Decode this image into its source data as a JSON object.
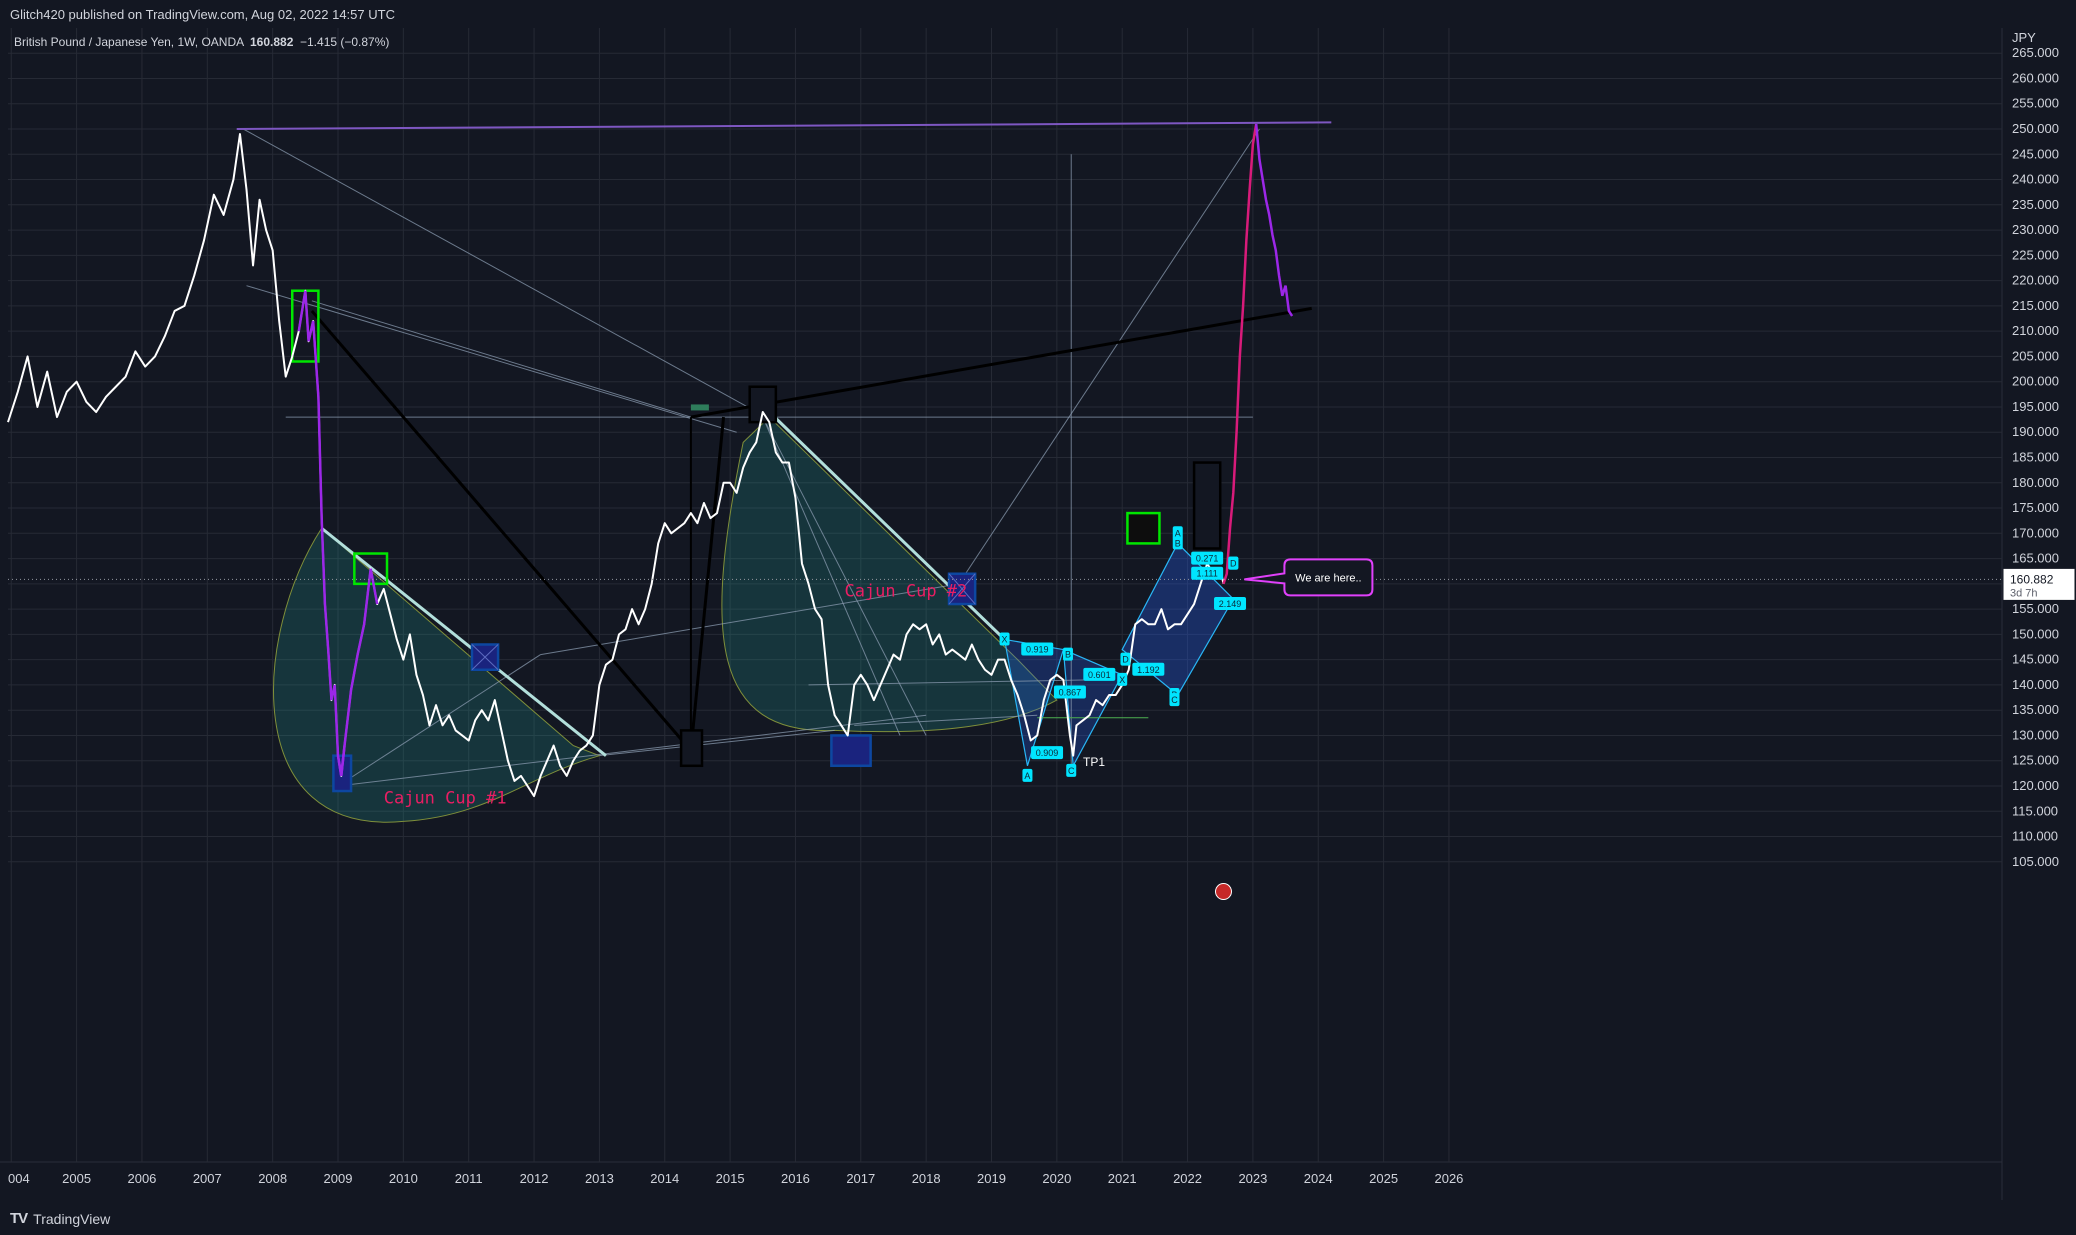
{
  "header": {
    "published": "Glitch420 published on TradingView.com, Aug 02, 2022 14:57 UTC"
  },
  "footer": {
    "brand": "TradingView"
  },
  "chart_data": {
    "type": "line",
    "legend": {
      "symbol": "British Pound / Japanese Yen, 1W, OANDA",
      "last": "160.882",
      "change": "−1.415 (−0.87%)"
    },
    "currency": "JPY",
    "last_price": 160.882,
    "last_price_label": "160.882",
    "countdown": "3d 7h",
    "x_ticks": [
      "004",
      "2005",
      "2006",
      "2007",
      "2008",
      "2009",
      "2010",
      "2011",
      "2012",
      "2013",
      "2014",
      "2015",
      "2016",
      "2017",
      "2018",
      "2019",
      "2020",
      "2021",
      "2022",
      "2023",
      "2024",
      "2025",
      "2026"
    ],
    "y_ticks": [
      "105.000",
      "110.000",
      "115.000",
      "120.000",
      "125.000",
      "130.000",
      "135.000",
      "140.000",
      "145.000",
      "150.000",
      "155.000",
      "160.000",
      "165.000",
      "170.000",
      "175.000",
      "180.000",
      "185.000",
      "190.000",
      "195.000",
      "200.000",
      "205.000",
      "210.000",
      "215.000",
      "220.000",
      "225.000",
      "230.000",
      "235.000",
      "240.000",
      "245.000",
      "250.000",
      "255.000",
      "260.000",
      "265.000"
    ],
    "ylim": [
      100,
      270
    ],
    "xlim": [
      2003.95,
      2027.5
    ],
    "price_series": {
      "color": "#ffffff",
      "points": [
        [
          2003.95,
          192
        ],
        [
          2004.1,
          198
        ],
        [
          2004.25,
          205
        ],
        [
          2004.4,
          195
        ],
        [
          2004.55,
          202
        ],
        [
          2004.7,
          193
        ],
        [
          2004.85,
          198
        ],
        [
          2005.0,
          200
        ],
        [
          2005.15,
          196
        ],
        [
          2005.3,
          194
        ],
        [
          2005.45,
          197
        ],
        [
          2005.6,
          199
        ],
        [
          2005.75,
          201
        ],
        [
          2005.9,
          206
        ],
        [
          2006.05,
          203
        ],
        [
          2006.2,
          205
        ],
        [
          2006.35,
          209
        ],
        [
          2006.5,
          214
        ],
        [
          2006.65,
          215
        ],
        [
          2006.8,
          221
        ],
        [
          2006.95,
          228
        ],
        [
          2007.1,
          237
        ],
        [
          2007.25,
          233
        ],
        [
          2007.4,
          240
        ],
        [
          2007.5,
          249
        ],
        [
          2007.6,
          238
        ],
        [
          2007.7,
          223
        ],
        [
          2007.8,
          236
        ],
        [
          2007.9,
          230
        ],
        [
          2008.0,
          226
        ],
        [
          2008.1,
          212
        ],
        [
          2008.2,
          201
        ],
        [
          2008.3,
          205
        ],
        [
          2008.4,
          210
        ],
        [
          2008.5,
          218
        ],
        [
          2008.55,
          208
        ],
        [
          2008.62,
          212
        ],
        [
          2008.7,
          197
        ],
        [
          2008.75,
          173
        ],
        [
          2008.8,
          156
        ],
        [
          2008.85,
          147
        ],
        [
          2008.9,
          137
        ],
        [
          2008.95,
          140
        ],
        [
          2009.0,
          126
        ],
        [
          2009.05,
          122
        ],
        [
          2009.1,
          128
        ],
        [
          2009.2,
          139
        ],
        [
          2009.3,
          146
        ],
        [
          2009.4,
          152
        ],
        [
          2009.5,
          163
        ],
        [
          2009.6,
          156
        ],
        [
          2009.7,
          159
        ],
        [
          2009.8,
          154
        ],
        [
          2009.9,
          149
        ],
        [
          2010.0,
          145
        ],
        [
          2010.1,
          150
        ],
        [
          2010.2,
          142
        ],
        [
          2010.3,
          138
        ],
        [
          2010.4,
          132
        ],
        [
          2010.5,
          136
        ],
        [
          2010.6,
          132
        ],
        [
          2010.7,
          134
        ],
        [
          2010.8,
          131
        ],
        [
          2010.9,
          130
        ],
        [
          2011.0,
          129
        ],
        [
          2011.1,
          133
        ],
        [
          2011.2,
          135
        ],
        [
          2011.3,
          133
        ],
        [
          2011.4,
          137
        ],
        [
          2011.5,
          131
        ],
        [
          2011.6,
          125
        ],
        [
          2011.7,
          121
        ],
        [
          2011.8,
          122
        ],
        [
          2011.9,
          120
        ],
        [
          2012.0,
          118
        ],
        [
          2012.1,
          122
        ],
        [
          2012.2,
          125
        ],
        [
          2012.3,
          128
        ],
        [
          2012.4,
          124
        ],
        [
          2012.5,
          122
        ],
        [
          2012.6,
          125
        ],
        [
          2012.7,
          127
        ],
        [
          2012.8,
          128
        ],
        [
          2012.9,
          130
        ],
        [
          2013.0,
          140
        ],
        [
          2013.1,
          144
        ],
        [
          2013.2,
          145
        ],
        [
          2013.3,
          150
        ],
        [
          2013.4,
          151
        ],
        [
          2013.5,
          155
        ],
        [
          2013.6,
          152
        ],
        [
          2013.7,
          155
        ],
        [
          2013.8,
          160
        ],
        [
          2013.9,
          168
        ],
        [
          2014.0,
          172
        ],
        [
          2014.1,
          170
        ],
        [
          2014.2,
          171
        ],
        [
          2014.3,
          172
        ],
        [
          2014.4,
          174
        ],
        [
          2014.5,
          172
        ],
        [
          2014.6,
          176
        ],
        [
          2014.7,
          173
        ],
        [
          2014.8,
          174
        ],
        [
          2014.9,
          180
        ],
        [
          2015.0,
          180
        ],
        [
          2015.1,
          178
        ],
        [
          2015.2,
          183
        ],
        [
          2015.3,
          186
        ],
        [
          2015.4,
          188
        ],
        [
          2015.5,
          194
        ],
        [
          2015.6,
          192
        ],
        [
          2015.7,
          186
        ],
        [
          2015.8,
          184
        ],
        [
          2015.9,
          184
        ],
        [
          2016.0,
          177
        ],
        [
          2016.1,
          164
        ],
        [
          2016.2,
          160
        ],
        [
          2016.3,
          155
        ],
        [
          2016.4,
          153
        ],
        [
          2016.5,
          140
        ],
        [
          2016.6,
          134
        ],
        [
          2016.7,
          132
        ],
        [
          2016.8,
          130
        ],
        [
          2016.9,
          140
        ],
        [
          2017.0,
          142
        ],
        [
          2017.1,
          140
        ],
        [
          2017.2,
          137
        ],
        [
          2017.3,
          140
        ],
        [
          2017.4,
          143
        ],
        [
          2017.5,
          146
        ],
        [
          2017.6,
          145
        ],
        [
          2017.7,
          150
        ],
        [
          2017.8,
          152
        ],
        [
          2017.9,
          151
        ],
        [
          2018.0,
          152
        ],
        [
          2018.1,
          148
        ],
        [
          2018.2,
          150
        ],
        [
          2018.3,
          146
        ],
        [
          2018.4,
          147
        ],
        [
          2018.5,
          146
        ],
        [
          2018.6,
          145
        ],
        [
          2018.7,
          148
        ],
        [
          2018.8,
          145
        ],
        [
          2018.9,
          143
        ],
        [
          2019.0,
          142
        ],
        [
          2019.1,
          145
        ],
        [
          2019.2,
          145
        ],
        [
          2019.3,
          141
        ],
        [
          2019.4,
          138
        ],
        [
          2019.5,
          134
        ],
        [
          2019.6,
          129
        ],
        [
          2019.7,
          130
        ],
        [
          2019.8,
          137
        ],
        [
          2019.9,
          141
        ],
        [
          2020.0,
          142
        ],
        [
          2020.1,
          141
        ],
        [
          2020.2,
          130
        ],
        [
          2020.25,
          126
        ],
        [
          2020.3,
          132
        ],
        [
          2020.4,
          133
        ],
        [
          2020.5,
          134
        ],
        [
          2020.6,
          137
        ],
        [
          2020.7,
          136
        ],
        [
          2020.8,
          138
        ],
        [
          2020.9,
          138
        ],
        [
          2021.0,
          140
        ],
        [
          2021.1,
          143
        ],
        [
          2021.2,
          152
        ],
        [
          2021.3,
          153
        ],
        [
          2021.4,
          152
        ],
        [
          2021.5,
          152
        ],
        [
          2021.6,
          155
        ],
        [
          2021.7,
          151
        ],
        [
          2021.8,
          152
        ],
        [
          2021.9,
          152
        ],
        [
          2022.0,
          154
        ],
        [
          2022.1,
          156
        ],
        [
          2022.2,
          160
        ],
        [
          2022.3,
          164
        ],
        [
          2022.4,
          162
        ],
        [
          2022.5,
          163
        ],
        [
          2022.55,
          160
        ]
      ]
    },
    "projection_series": {
      "color_up": "#d81b7a",
      "color_down": "#9c27e8",
      "points": [
        [
          2022.55,
          160
        ],
        [
          2022.6,
          162
        ],
        [
          2022.65,
          171
        ],
        [
          2022.7,
          178
        ],
        [
          2022.75,
          190
        ],
        [
          2022.8,
          205
        ],
        [
          2022.85,
          215
        ],
        [
          2022.9,
          228
        ],
        [
          2022.95,
          238
        ],
        [
          2023.0,
          247
        ],
        [
          2023.05,
          251
        ],
        [
          2023.1,
          244
        ],
        [
          2023.15,
          240
        ],
        [
          2023.2,
          236
        ],
        [
          2023.25,
          233
        ],
        [
          2023.3,
          229
        ],
        [
          2023.35,
          226
        ],
        [
          2023.4,
          221
        ],
        [
          2023.45,
          217
        ],
        [
          2023.5,
          219
        ],
        [
          2023.55,
          214
        ],
        [
          2023.6,
          213
        ]
      ]
    },
    "annotations": {
      "cup1_label": "Cajun Cup #1",
      "cup2_label": "Cajun Cup #2",
      "callout": "We are here..",
      "tp_label": "TP1",
      "pattern_letters": [
        "X",
        "A",
        "B",
        "C",
        "D",
        "X",
        "A",
        "B",
        "C",
        "D",
        "B",
        "C",
        "D"
      ],
      "pattern_ratios": [
        "0.919",
        "0.909",
        "0.867",
        "0.601",
        "1.192",
        "0.271",
        "1.111",
        "2.149"
      ]
    }
  }
}
